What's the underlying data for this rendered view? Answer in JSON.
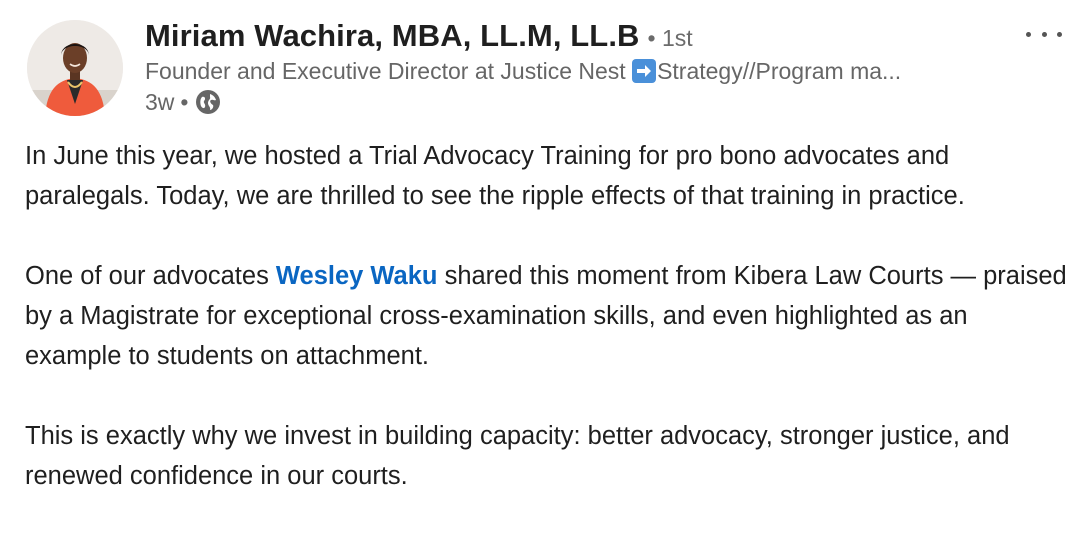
{
  "post": {
    "author": {
      "name": "Miriam Wachira, MBA, LL.M, LL.B",
      "connection_degree": "• 1st",
      "headline_prefix": "Founder and Executive Director at Justice Nest",
      "headline_suffix": "Strategy//Program ma...",
      "avatar_icon": "profile-photo"
    },
    "meta": {
      "time_ago": "3w",
      "separator": "•",
      "visibility_icon": "globe-icon"
    },
    "more_icon": "ellipsis-icon",
    "body": {
      "paragraph1": "In June this year, we hosted a Trial Advocacy Training for pro bono advocates and paralegals. Today, we are thrilled to see the ripple effects of that training in practice.",
      "paragraph2_before": "One of our advocates ",
      "paragraph2_mention": "Wesley Waku",
      "paragraph2_after": " shared this moment from Kibera Law Courts — praised by a Magistrate for exceptional cross-examination skills, and even highlighted as an example to students on attachment.",
      "paragraph3": "This is exactly why we invest in building capacity: better advocacy, stronger justice, and renewed confidence in our courts."
    },
    "colors": {
      "mention": "#0a66c2",
      "text": "#1f1f1f",
      "secondary_text": "#666666",
      "arrow_emoji_bg": "#4a90d9"
    }
  }
}
